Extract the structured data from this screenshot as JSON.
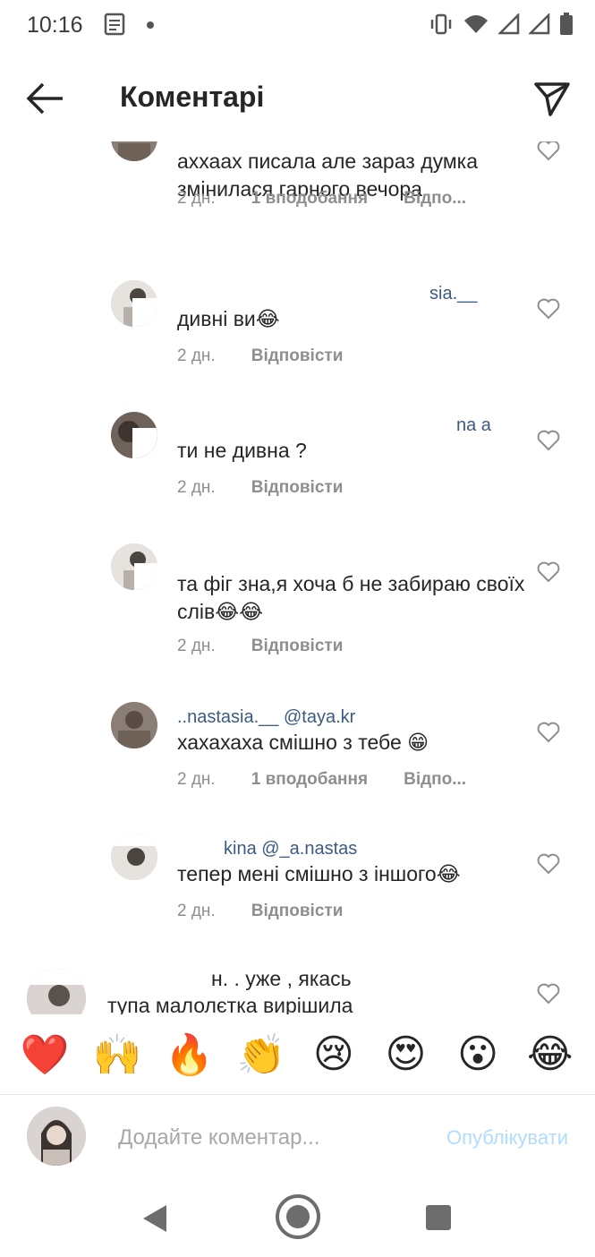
{
  "status_bar": {
    "time": "10:16"
  },
  "header": {
    "title": "Коментарі"
  },
  "comments": [
    {
      "username_fragment": "",
      "text": "аххаах писала але зараз думка змінилася гарного вечора",
      "time": "2 дн.",
      "likes": "1 вподобання",
      "reply": "Відпо..."
    },
    {
      "username_fragment": "sia.__",
      "text": "дивні ви😂",
      "time": "2 дн.",
      "likes": "",
      "reply": "Відповісти"
    },
    {
      "username_fragment": "na а",
      "text": "ти не дивна ?",
      "time": "2 дн.",
      "likes": "",
      "reply": "Відповісти"
    },
    {
      "username_fragment": "",
      "text": "та фіг зна,я хоча б не забираю своїх слів😂😂",
      "time": "2 дн.",
      "likes": "",
      "reply": "Відповісти"
    },
    {
      "username_fragment": "..nastasia.__ @taya.kr",
      "text": "хахахаха смішно з тебе 😁",
      "time": "2 дн.",
      "likes": "1 вподобання",
      "reply": "Відпо..."
    },
    {
      "username_fragment": "kina @_a.nastas",
      "text": "тепер мені смішно з іншого😂",
      "time": "2 дн.",
      "likes": "",
      "reply": "Відповісти"
    },
    {
      "username_fragment": "н. . уже , якась",
      "text": "тупа малолєтка вирішила",
      "time": "",
      "likes": "",
      "reply": ""
    }
  ],
  "emoji_bar": {
    "items": [
      "❤️",
      "🙌",
      "🔥",
      "👏",
      "😢",
      "😍",
      "😮",
      "😂"
    ],
    "colors": {
      "heart": "#e0245e"
    }
  },
  "input": {
    "placeholder": "Додайте коментар...",
    "value": "",
    "publish_label": "Опублікувати",
    "publish_color": "#b3dbff"
  }
}
